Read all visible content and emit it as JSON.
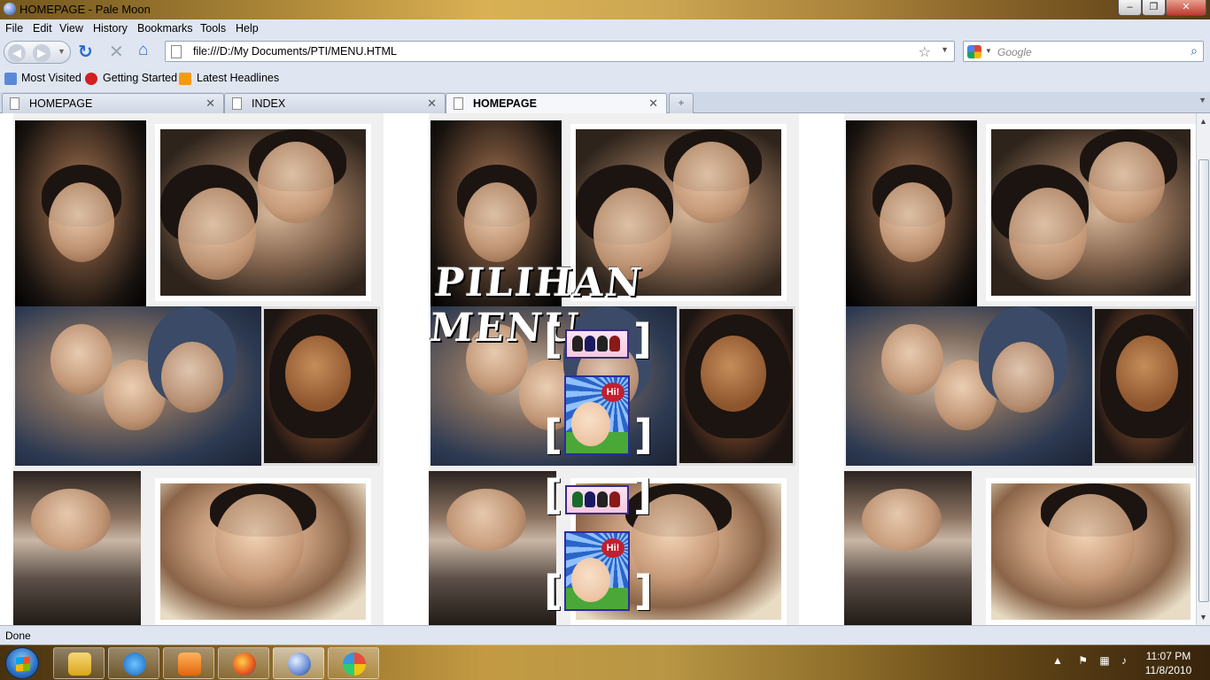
{
  "window": {
    "title": "HOMEPAGE - Pale Moon",
    "min": "–",
    "max": "❐",
    "close": "✕"
  },
  "menubar": [
    "File",
    "Edit",
    "View",
    "History",
    "Bookmarks",
    "Tools",
    "Help"
  ],
  "navbar": {
    "url": "file:///D:/My Documents/PTI/MENU.HTML",
    "search_placeholder": "Google",
    "back_icon": "back-arrow-icon",
    "forward_icon": "forward-arrow-icon",
    "reload_icon": "reload-icon",
    "stop_icon": "stop-icon",
    "home_icon": "home-icon"
  },
  "bookmarks": [
    "Most Visited",
    "Getting Started",
    "Latest Headlines"
  ],
  "tabs": [
    {
      "label": "HOMEPAGE",
      "active": false
    },
    {
      "label": "INDEX",
      "active": false
    },
    {
      "label": "HOMEPAGE",
      "active": true
    }
  ],
  "page": {
    "menu_title": "PILIHAN MENU",
    "badge_text": "Hi!"
  },
  "status": "Done",
  "taskbar": {
    "apps": [
      "explorer",
      "internet-explorer",
      "media-player",
      "firefox",
      "pale-moon",
      "paint"
    ],
    "time": "11:07 PM",
    "date": "11/8/2010"
  },
  "colors": {
    "chrome_bg": "#dfe6f1",
    "menu_border": "#2c2ca0"
  }
}
